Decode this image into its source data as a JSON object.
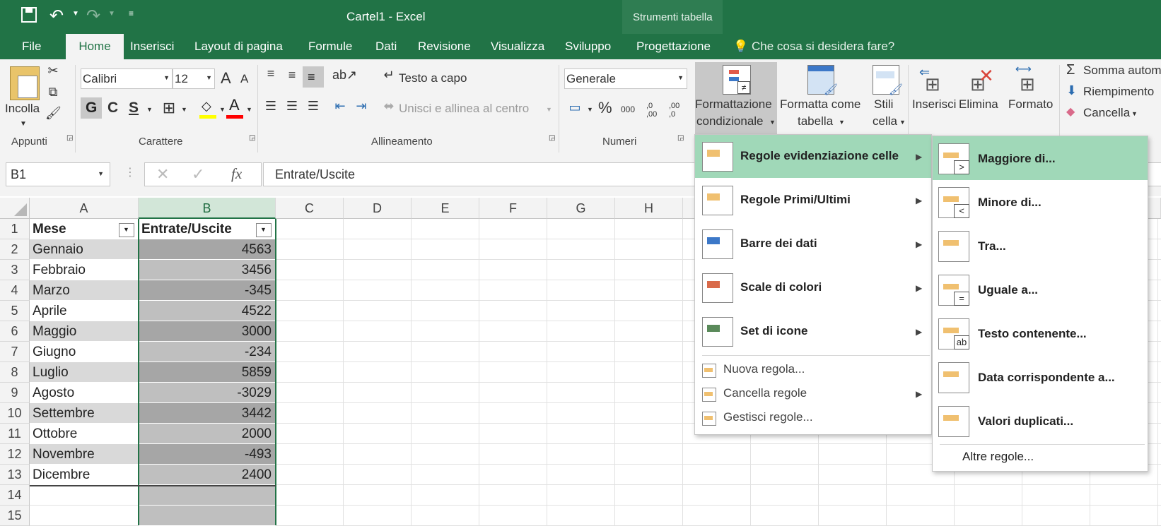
{
  "app": {
    "title": "Cartel1 - Excel",
    "context_tab_group": "Strumenti tabella"
  },
  "tabs": [
    "File",
    "Home",
    "Inserisci",
    "Layout di pagina",
    "Formule",
    "Dati",
    "Revisione",
    "Visualizza",
    "Sviluppo",
    "Progettazione"
  ],
  "tell_me": "Che cosa si desidera fare?",
  "ribbon": {
    "clipboard": {
      "paste": "Incolla",
      "group": "Appunti"
    },
    "font": {
      "name": "Calibri",
      "size": "12",
      "bold": "G",
      "italic": "C",
      "underline": "S",
      "group": "Carattere",
      "grow": "A",
      "shrink": "A",
      "color_letter": "A"
    },
    "align": {
      "wrap": "Testo a capo",
      "merge": "Unisci e allinea al centro",
      "group": "Allineamento"
    },
    "number": {
      "format": "Generale",
      "percent": "%",
      "thousands": "000",
      "inc": ",0 ,00",
      "dec": ",00 ,0",
      "group": "Numeri"
    },
    "styles": {
      "conditional_l1": "Formattazione",
      "conditional_l2": "condizionale",
      "table_l1": "Formatta come",
      "table_l2": "tabella",
      "cell_l1": "Stili",
      "cell_l2": "cella"
    },
    "cells": {
      "insert": "Inserisci",
      "delete": "Elimina",
      "format": "Formato"
    },
    "editing": {
      "sum": "Somma autom",
      "fill": "Riempimento",
      "clear": "Cancella"
    }
  },
  "formula_bar": {
    "name_box": "B1",
    "fx": "fx",
    "content": "Entrate/Uscite"
  },
  "columns": [
    "A",
    "B",
    "C",
    "D",
    "E",
    "F",
    "G",
    "H"
  ],
  "rows": [
    1,
    2,
    3,
    4,
    5,
    6,
    7,
    8,
    9,
    10,
    11,
    12,
    13,
    14,
    15
  ],
  "table": {
    "headers": [
      "Mese",
      "Entrate/Uscite"
    ],
    "data": [
      [
        "Gennaio",
        "4563"
      ],
      [
        "Febbraio",
        "3456"
      ],
      [
        "Marzo",
        "-345"
      ],
      [
        "Aprile",
        "4522"
      ],
      [
        "Maggio",
        "3000"
      ],
      [
        "Giugno",
        "-234"
      ],
      [
        "Luglio",
        "5859"
      ],
      [
        "Agosto",
        "-3029"
      ],
      [
        "Settembre",
        "3442"
      ],
      [
        "Ottobre",
        "2000"
      ],
      [
        "Novembre",
        "-493"
      ],
      [
        "Dicembre",
        "2400"
      ]
    ]
  },
  "cf_menu": {
    "items": [
      "Regole evidenziazione celle",
      "Regole Primi/Ultimi",
      "Barre dei dati",
      "Scale di colori",
      "Set di icone"
    ],
    "small_items": [
      "Nuova regola...",
      "Cancella regole",
      "Gestisci regole..."
    ]
  },
  "submenu": {
    "items": [
      "Maggiore di...",
      "Minore di...",
      "Tra...",
      "Uguale a...",
      "Testo contenente...",
      "Data corrispondente a...",
      "Valori duplicati..."
    ],
    "more": "Altre regole...",
    "icon_glyphs": [
      ">",
      "<",
      "",
      "=",
      "ab",
      "",
      ""
    ]
  },
  "colors": {
    "excel_green": "#217346",
    "menu_highlight": "#a0d8b8",
    "table_band_dark": "#d9d9d9",
    "b_band_dark": "#a6a6a6",
    "b_band_light": "#bfbfbf"
  }
}
